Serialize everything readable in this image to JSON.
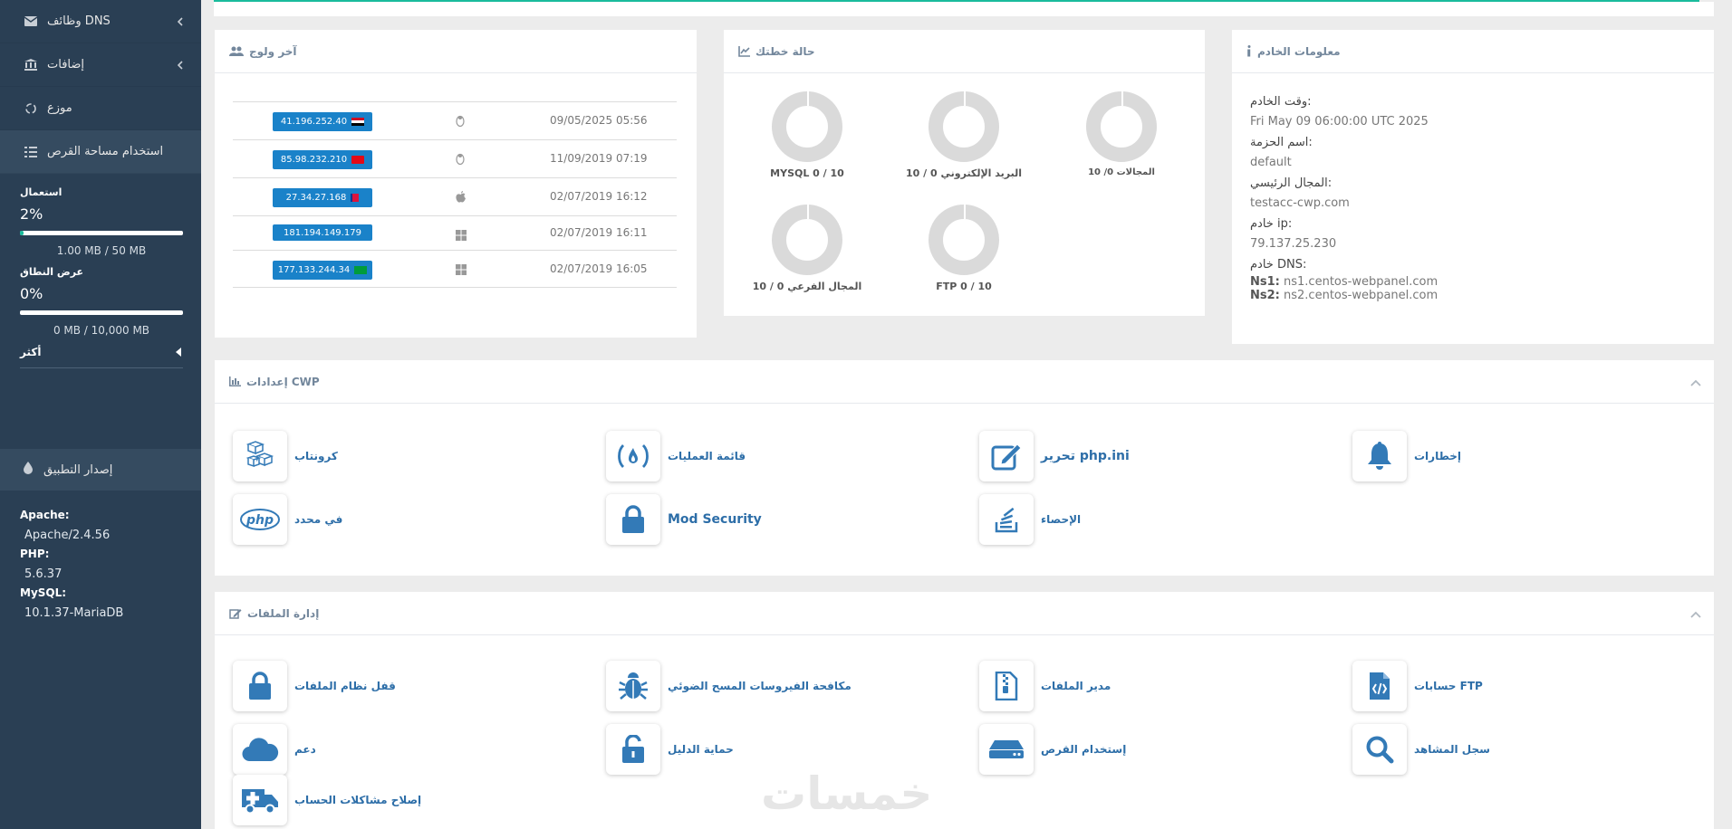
{
  "sidebar": {
    "items": [
      {
        "label": "وظائف DNS",
        "icon": "envelope-icon",
        "chevron": true
      },
      {
        "label": "إضافات",
        "icon": "bank-icon",
        "chevron": true
      },
      {
        "label": "موزع",
        "icon": "recycle-icon",
        "chevron": false
      },
      {
        "label": "استخدام مساحة القرص",
        "icon": "tasks-icon",
        "chevron": false
      }
    ],
    "disk": {
      "label": "استعمال",
      "percent_text": "2%",
      "fill": 0.02,
      "caption": "1.00 MB / 50 MB"
    },
    "bandwidth": {
      "label": "عرض النطاق",
      "percent_text": "0%",
      "fill": 0.0,
      "caption": "0 MB / 10,000 MB"
    },
    "more_label": "أكثر",
    "app_version_label": "إصدار التطبيق",
    "versions": [
      {
        "key": "Apache:",
        "value": "Apache/2.4.56"
      },
      {
        "key": "PHP:",
        "value": "5.6.37"
      },
      {
        "key": "MySQL:",
        "value": "10.1.37-MariaDB"
      }
    ]
  },
  "last_login": {
    "title": "آخر ولوج",
    "rows": [
      {
        "ip": "41.196.252.40",
        "flag": "egypt",
        "os": "linux-icon",
        "date": "09/05/2025 05:56"
      },
      {
        "ip": "85.98.232.210",
        "flag": "turkey",
        "os": "linux-icon",
        "date": "11/09/2019 07:19"
      },
      {
        "ip": "27.34.27.168",
        "flag": "nepal",
        "os": "apple-icon",
        "date": "02/07/2019 16:12"
      },
      {
        "ip": "181.194.149.179",
        "flag": "",
        "os": "windows-icon",
        "date": "02/07/2019 16:11"
      },
      {
        "ip": "177.133.244.34",
        "flag": "brazil",
        "os": "windows-icon",
        "date": "02/07/2019 16:05"
      }
    ]
  },
  "plan_status": {
    "title": "حالة خطتك",
    "items": [
      {
        "label": "MYSQL 0 / 10"
      },
      {
        "label": "البريد الإلكتروني 0 / 10"
      },
      {
        "label": "المجالات 0/ 10"
      },
      {
        "label": "المجال الفرعي 0 / 10"
      },
      {
        "label": "FTP 0 / 10"
      }
    ]
  },
  "server_info": {
    "title": "معلومات الخادم",
    "fields": [
      {
        "key": "وقت الخادم:",
        "value": "Fri May 09 06:00:00 UTC 2025"
      },
      {
        "key": "اسم الحزمة:",
        "value": "default"
      },
      {
        "key": "المجال الرئيسي:",
        "value": "testacc-cwp.com"
      },
      {
        "key": "خادم ip:",
        "value": "79.137.25.230"
      }
    ],
    "dns_key": "خادم DNS:",
    "ns1_key": "Ns1:",
    "ns1": "ns1.centos-webpanel.com",
    "ns2_key": "Ns2:",
    "ns2": "ns2.centos-webpanel.com"
  },
  "cwp_settings": {
    "title": "إعدادات CWP",
    "tiles": [
      {
        "label": "كرونتاب",
        "icon": "cubes-icon"
      },
      {
        "label": "قائمة العمليات",
        "icon": "process-icon"
      },
      {
        "label": "تحرير php.ini",
        "icon": "edit-icon"
      },
      {
        "label": "إخطارات",
        "icon": "bell-icon"
      },
      {
        "label": "في محدد",
        "icon": "php-icon"
      },
      {
        "label": "Mod Security",
        "icon": "lock-icon"
      },
      {
        "label": "الإحصاء",
        "icon": "stack-icon"
      }
    ]
  },
  "file_management": {
    "title": "إدارة الملفات",
    "tiles": [
      {
        "label": "قفل نظام الملفات",
        "icon": "lock-icon"
      },
      {
        "label": "مكافحة الفيروسات المسح الضوئي",
        "icon": "bug-icon"
      },
      {
        "label": "مدير الملفات",
        "icon": "file-zip-icon"
      },
      {
        "label": "حسابات FTP",
        "icon": "file-code-icon"
      },
      {
        "label": "دعم",
        "icon": "cloud-icon"
      },
      {
        "label": "حماية الدليل",
        "icon": "unlock-icon"
      },
      {
        "label": "إستخدام القرص",
        "icon": "hdd-icon"
      },
      {
        "label": "سجل المشاهد",
        "icon": "search-icon"
      },
      {
        "label": "إصلاح مشاكلات الحساب",
        "icon": "ambulance-icon"
      }
    ]
  },
  "watermark": "خمسات"
}
